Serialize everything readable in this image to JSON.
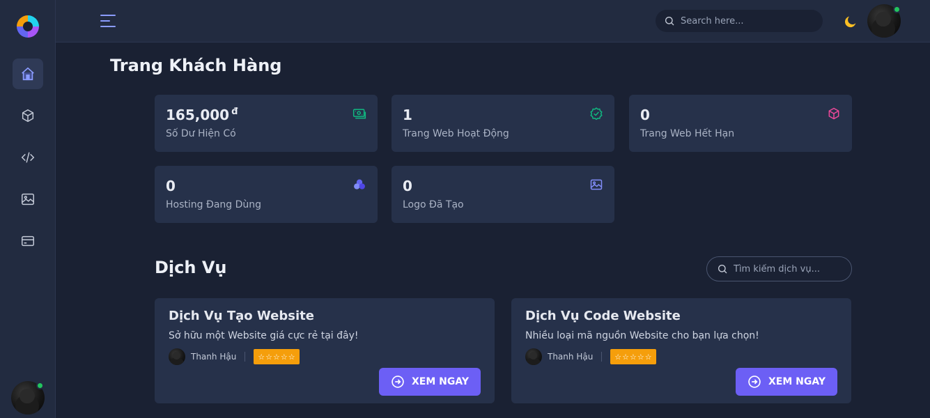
{
  "header": {
    "search_placeholder": "Search here..."
  },
  "page": {
    "title": "Trang Khách Hàng"
  },
  "stats": [
    {
      "value": "165,000",
      "unit": "đ",
      "label": "Số Dư Hiện Có",
      "icon": "money-icon",
      "color": "#10b981"
    },
    {
      "value": "1",
      "label": "Trang Web Hoạt Động",
      "icon": "check-circle-icon",
      "color": "#10b981"
    },
    {
      "value": "0",
      "label": "Trang Web Hết Hạn",
      "icon": "cube-icon",
      "color": "#ec4899"
    },
    {
      "value": "0",
      "label": "Hosting Đang Dùng",
      "icon": "server-icon",
      "color": "#6366f1"
    },
    {
      "value": "0",
      "label": "Logo Đã Tạo",
      "icon": "image-icon",
      "color": "#818cf8"
    }
  ],
  "services_section": {
    "title": "Dịch Vụ",
    "search_placeholder": "Tìm kiếm dịch vụ..."
  },
  "services": [
    {
      "title": "Dịch Vụ Tạo Website",
      "description": "Sở hữu một Website giá cực rẻ tại đây!",
      "author": "Thanh Hậu",
      "rating": 5,
      "button_label": "XEM NGAY"
    },
    {
      "title": "Dịch Vụ Code Website",
      "description": "Nhiều loại mã nguồn Website cho bạn lựa chọn!",
      "author": "Thanh Hậu",
      "rating": 5,
      "button_label": "XEM NGAY"
    }
  ],
  "colors": {
    "accent": "#6c5ff5",
    "rating": "#f59e0b",
    "online": "#22c55e",
    "moon": "#fbbf24"
  }
}
